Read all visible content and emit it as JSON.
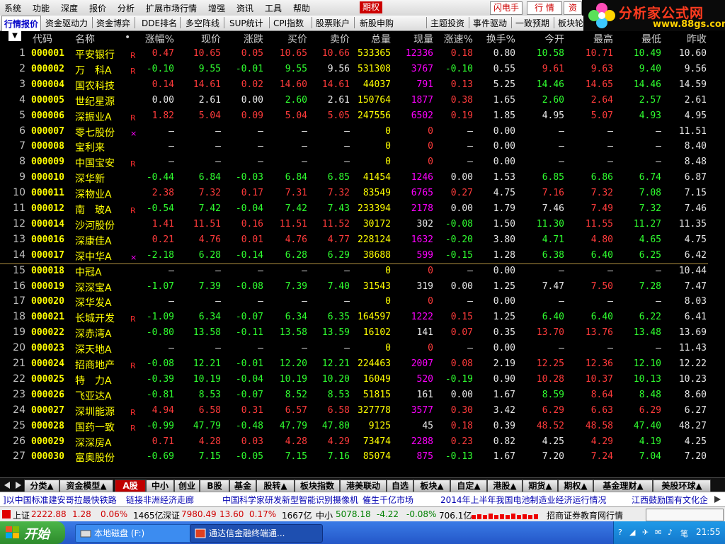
{
  "menu": {
    "items": [
      "系统",
      "功能",
      "深度",
      "报价",
      "分析",
      "扩展市场行情",
      "增强",
      "资讯",
      "工具",
      "帮助",
      "期权"
    ],
    "flash_trade": "闪电手",
    "quote": "行 情",
    "info": "资"
  },
  "logo": {
    "brand": "分析家公式网",
    "url": "www.88gs.com"
  },
  "func_tabs": [
    "行情报价",
    "资金驱动力",
    "资金博弈",
    "DDE排名",
    "多空阵线",
    "SUP统计",
    "CPI指数",
    "股票账户",
    "新股申购",
    "主题投资",
    "事件驱动",
    "一致预期",
    "板块轮"
  ],
  "table": {
    "headers": {
      "idx": "▼",
      "code": "代码",
      "name": "名称",
      "dot": "•",
      "cols": [
        "涨幅%",
        "现价",
        "涨跌",
        "买价",
        "卖价",
        "总量",
        "现量",
        "涨速%",
        "换手%",
        "今开",
        "最高",
        "最低",
        "昨收"
      ]
    },
    "rows": [
      {
        "i": "1",
        "code": "000001",
        "name": "平安银行",
        "flag": "R",
        "v": [
          "0.47",
          "10.65",
          "0.05",
          "10.65",
          "10.66",
          "533365",
          "12336",
          "0.18",
          "0.80",
          "10.58",
          "10.71",
          "10.49",
          "10.60"
        ],
        "c": [
          "u",
          "u",
          "u",
          "u",
          "u",
          "y",
          "m",
          "u",
          "w",
          "d",
          "u",
          "d",
          "w"
        ]
      },
      {
        "i": "2",
        "code": "000002",
        "name": "万　科A",
        "flag": "R",
        "v": [
          "-0.10",
          "9.55",
          "-0.01",
          "9.55",
          "9.56",
          "531308",
          "3767",
          "-0.10",
          "0.55",
          "9.61",
          "9.63",
          "9.40",
          "9.56"
        ],
        "c": [
          "d",
          "d",
          "d",
          "d",
          "w",
          "y",
          "m",
          "d",
          "w",
          "u",
          "u",
          "d",
          "w"
        ]
      },
      {
        "i": "3",
        "code": "000004",
        "name": "国农科技",
        "flag": "",
        "v": [
          "0.14",
          "14.61",
          "0.02",
          "14.60",
          "14.61",
          "44037",
          "791",
          "0.13",
          "5.25",
          "14.46",
          "14.65",
          "14.46",
          "14.59"
        ],
        "c": [
          "u",
          "u",
          "u",
          "u",
          "u",
          "y",
          "m",
          "u",
          "w",
          "d",
          "u",
          "d",
          "w"
        ]
      },
      {
        "i": "4",
        "code": "000005",
        "name": "世纪星源",
        "flag": "",
        "v": [
          "0.00",
          "2.61",
          "0.00",
          "2.60",
          "2.61",
          "150764",
          "1877",
          "0.38",
          "1.65",
          "2.60",
          "2.64",
          "2.57",
          "2.61"
        ],
        "c": [
          "w",
          "w",
          "w",
          "d",
          "w",
          "y",
          "m",
          "u",
          "w",
          "d",
          "u",
          "d",
          "w"
        ]
      },
      {
        "i": "5",
        "code": "000006",
        "name": "深振业A",
        "flag": "R",
        "v": [
          "1.82",
          "5.04",
          "0.09",
          "5.04",
          "5.05",
          "247556",
          "6502",
          "0.19",
          "1.85",
          "4.95",
          "5.07",
          "4.93",
          "4.95"
        ],
        "c": [
          "u",
          "u",
          "u",
          "u",
          "u",
          "y",
          "m",
          "u",
          "w",
          "w",
          "u",
          "d",
          "w"
        ]
      },
      {
        "i": "6",
        "code": "000007",
        "name": "零七股份",
        "flag": "×",
        "v": [
          "—",
          "—",
          "—",
          "—",
          "—",
          "0",
          "0",
          "—",
          "0.00",
          "—",
          "—",
          "—",
          "11.51"
        ],
        "c": [
          "w",
          "w",
          "w",
          "w",
          "w",
          "y",
          "u",
          "w",
          "w",
          "w",
          "w",
          "w",
          "w"
        ]
      },
      {
        "i": "7",
        "code": "000008",
        "name": "宝利来",
        "flag": "",
        "v": [
          "—",
          "—",
          "—",
          "—",
          "—",
          "0",
          "0",
          "—",
          "0.00",
          "—",
          "—",
          "—",
          "8.40"
        ],
        "c": [
          "w",
          "w",
          "w",
          "w",
          "w",
          "y",
          "u",
          "w",
          "w",
          "w",
          "w",
          "w",
          "w"
        ]
      },
      {
        "i": "8",
        "code": "000009",
        "name": "中国宝安",
        "flag": "R",
        "v": [
          "—",
          "—",
          "—",
          "—",
          "—",
          "0",
          "0",
          "—",
          "0.00",
          "—",
          "—",
          "—",
          "8.48"
        ],
        "c": [
          "w",
          "w",
          "w",
          "w",
          "w",
          "y",
          "u",
          "w",
          "w",
          "w",
          "w",
          "w",
          "w"
        ]
      },
      {
        "i": "9",
        "code": "000010",
        "name": "深华新",
        "flag": "",
        "v": [
          "-0.44",
          "6.84",
          "-0.03",
          "6.84",
          "6.85",
          "41454",
          "1246",
          "0.00",
          "1.53",
          "6.85",
          "6.86",
          "6.74",
          "6.87"
        ],
        "c": [
          "d",
          "d",
          "d",
          "d",
          "d",
          "y",
          "m",
          "w",
          "w",
          "d",
          "d",
          "d",
          "w"
        ]
      },
      {
        "i": "10",
        "code": "000011",
        "name": "深物业A",
        "flag": "",
        "v": [
          "2.38",
          "7.32",
          "0.17",
          "7.31",
          "7.32",
          "83549",
          "6765",
          "0.27",
          "4.75",
          "7.16",
          "7.32",
          "7.08",
          "7.15"
        ],
        "c": [
          "u",
          "u",
          "u",
          "u",
          "u",
          "y",
          "m",
          "u",
          "w",
          "u",
          "u",
          "d",
          "w"
        ]
      },
      {
        "i": "11",
        "code": "000012",
        "name": "南　玻A",
        "flag": "R",
        "v": [
          "-0.54",
          "7.42",
          "-0.04",
          "7.42",
          "7.43",
          "233394",
          "2178",
          "0.00",
          "1.79",
          "7.46",
          "7.49",
          "7.32",
          "7.46"
        ],
        "c": [
          "d",
          "d",
          "d",
          "d",
          "d",
          "y",
          "m",
          "w",
          "w",
          "w",
          "u",
          "d",
          "w"
        ]
      },
      {
        "i": "12",
        "code": "000014",
        "name": "沙河股份",
        "flag": "",
        "v": [
          "1.41",
          "11.51",
          "0.16",
          "11.51",
          "11.52",
          "30172",
          "302",
          "-0.08",
          "1.50",
          "11.30",
          "11.55",
          "11.27",
          "11.35"
        ],
        "c": [
          "u",
          "u",
          "u",
          "u",
          "u",
          "y",
          "w",
          "d",
          "w",
          "d",
          "u",
          "d",
          "w"
        ]
      },
      {
        "i": "13",
        "code": "000016",
        "name": "深康佳A",
        "flag": "",
        "v": [
          "0.21",
          "4.76",
          "0.01",
          "4.76",
          "4.77",
          "228124",
          "1632",
          "-0.20",
          "3.80",
          "4.71",
          "4.80",
          "4.65",
          "4.75"
        ],
        "c": [
          "u",
          "u",
          "u",
          "u",
          "u",
          "y",
          "m",
          "d",
          "w",
          "d",
          "u",
          "d",
          "w"
        ]
      },
      {
        "i": "14",
        "code": "000017",
        "name": "深中华A",
        "flag": "×",
        "v": [
          "-2.18",
          "6.28",
          "-0.14",
          "6.28",
          "6.29",
          "38688",
          "599",
          "-0.15",
          "1.28",
          "6.38",
          "6.40",
          "6.25",
          "6.42"
        ],
        "c": [
          "d",
          "d",
          "d",
          "d",
          "d",
          "y",
          "m",
          "d",
          "w",
          "d",
          "d",
          "d",
          "w"
        ]
      },
      {
        "i": "15",
        "code": "000018",
        "name": "中冠A",
        "flag": "",
        "v": [
          "—",
          "—",
          "—",
          "—",
          "—",
          "0",
          "0",
          "—",
          "0.00",
          "—",
          "—",
          "—",
          "10.44"
        ],
        "c": [
          "w",
          "w",
          "w",
          "w",
          "w",
          "y",
          "u",
          "w",
          "w",
          "w",
          "w",
          "w",
          "w"
        ]
      },
      {
        "i": "16",
        "code": "000019",
        "name": "深深宝A",
        "flag": "",
        "v": [
          "-1.07",
          "7.39",
          "-0.08",
          "7.39",
          "7.40",
          "31543",
          "319",
          "0.00",
          "1.25",
          "7.47",
          "7.50",
          "7.28",
          "7.47"
        ],
        "c": [
          "d",
          "d",
          "d",
          "d",
          "d",
          "y",
          "w",
          "w",
          "w",
          "w",
          "u",
          "d",
          "w"
        ]
      },
      {
        "i": "17",
        "code": "000020",
        "name": "深华发A",
        "flag": "",
        "v": [
          "—",
          "—",
          "—",
          "—",
          "—",
          "0",
          "0",
          "—",
          "0.00",
          "—",
          "—",
          "—",
          "8.03"
        ],
        "c": [
          "w",
          "w",
          "w",
          "w",
          "w",
          "y",
          "u",
          "w",
          "w",
          "w",
          "w",
          "w",
          "w"
        ]
      },
      {
        "i": "18",
        "code": "000021",
        "name": "长城开发",
        "flag": "R",
        "v": [
          "-1.09",
          "6.34",
          "-0.07",
          "6.34",
          "6.35",
          "164597",
          "1222",
          "0.15",
          "1.25",
          "6.40",
          "6.40",
          "6.22",
          "6.41"
        ],
        "c": [
          "d",
          "d",
          "d",
          "d",
          "d",
          "y",
          "m",
          "u",
          "w",
          "d",
          "d",
          "d",
          "w"
        ]
      },
      {
        "i": "19",
        "code": "000022",
        "name": "深赤湾A",
        "flag": "",
        "v": [
          "-0.80",
          "13.58",
          "-0.11",
          "13.58",
          "13.59",
          "16102",
          "141",
          "0.07",
          "0.35",
          "13.70",
          "13.76",
          "13.48",
          "13.69"
        ],
        "c": [
          "d",
          "d",
          "d",
          "d",
          "d",
          "y",
          "w",
          "u",
          "w",
          "u",
          "u",
          "d",
          "w"
        ]
      },
      {
        "i": "20",
        "code": "000023",
        "name": "深天地A",
        "flag": "",
        "v": [
          "—",
          "—",
          "—",
          "—",
          "—",
          "0",
          "0",
          "—",
          "0.00",
          "—",
          "—",
          "—",
          "11.43"
        ],
        "c": [
          "w",
          "w",
          "w",
          "w",
          "w",
          "y",
          "u",
          "w",
          "w",
          "w",
          "w",
          "w",
          "w"
        ]
      },
      {
        "i": "21",
        "code": "000024",
        "name": "招商地产",
        "flag": "R",
        "v": [
          "-0.08",
          "12.21",
          "-0.01",
          "12.20",
          "12.21",
          "224463",
          "2007",
          "0.08",
          "2.19",
          "12.25",
          "12.36",
          "12.10",
          "12.22"
        ],
        "c": [
          "d",
          "d",
          "d",
          "d",
          "d",
          "y",
          "m",
          "u",
          "w",
          "u",
          "u",
          "d",
          "w"
        ]
      },
      {
        "i": "22",
        "code": "000025",
        "name": "特　力A",
        "flag": "",
        "v": [
          "-0.39",
          "10.19",
          "-0.04",
          "10.19",
          "10.20",
          "16049",
          "520",
          "-0.19",
          "0.90",
          "10.28",
          "10.37",
          "10.13",
          "10.23"
        ],
        "c": [
          "d",
          "d",
          "d",
          "d",
          "d",
          "y",
          "m",
          "d",
          "w",
          "u",
          "u",
          "d",
          "w"
        ]
      },
      {
        "i": "23",
        "code": "000026",
        "name": "飞亚达A",
        "flag": "",
        "v": [
          "-0.81",
          "8.53",
          "-0.07",
          "8.52",
          "8.53",
          "51815",
          "161",
          "0.00",
          "1.67",
          "8.59",
          "8.64",
          "8.48",
          "8.60"
        ],
        "c": [
          "d",
          "d",
          "d",
          "d",
          "d",
          "y",
          "w",
          "w",
          "w",
          "d",
          "u",
          "d",
          "w"
        ]
      },
      {
        "i": "24",
        "code": "000027",
        "name": "深圳能源",
        "flag": "R",
        "v": [
          "4.94",
          "6.58",
          "0.31",
          "6.57",
          "6.58",
          "327778",
          "3577",
          "0.30",
          "3.42",
          "6.29",
          "6.63",
          "6.29",
          "6.27"
        ],
        "c": [
          "u",
          "u",
          "u",
          "u",
          "u",
          "y",
          "m",
          "u",
          "w",
          "u",
          "u",
          "u",
          "w"
        ]
      },
      {
        "i": "25",
        "code": "000028",
        "name": "国药一致",
        "flag": "R",
        "v": [
          "-0.99",
          "47.79",
          "-0.48",
          "47.79",
          "47.80",
          "9125",
          "45",
          "0.18",
          "0.39",
          "48.52",
          "48.58",
          "47.40",
          "48.27"
        ],
        "c": [
          "d",
          "d",
          "d",
          "d",
          "d",
          "y",
          "w",
          "u",
          "w",
          "u",
          "u",
          "d",
          "w"
        ]
      },
      {
        "i": "26",
        "code": "000029",
        "name": "深深房A",
        "flag": "",
        "v": [
          "0.71",
          "4.28",
          "0.03",
          "4.28",
          "4.29",
          "73474",
          "2288",
          "0.23",
          "0.82",
          "4.25",
          "4.29",
          "4.19",
          "4.25"
        ],
        "c": [
          "u",
          "u",
          "u",
          "u",
          "u",
          "y",
          "m",
          "u",
          "w",
          "w",
          "u",
          "d",
          "w"
        ]
      },
      {
        "i": "27",
        "code": "000030",
        "name": "富奥股份",
        "flag": "",
        "v": [
          "-0.69",
          "7.15",
          "-0.05",
          "7.15",
          "7.16",
          "85074",
          "875",
          "-0.13",
          "1.67",
          "7.20",
          "7.24",
          "7.04",
          "7.20"
        ],
        "c": [
          "d",
          "d",
          "d",
          "d",
          "d",
          "y",
          "m",
          "d",
          "w",
          "w",
          "u",
          "d",
          "w"
        ]
      }
    ]
  },
  "bottom_tabs": [
    "分类▲",
    "资金模型▲",
    "A股",
    "中小",
    "创业",
    "B股",
    "基金",
    "股转▲",
    "板块指数",
    "港美联动",
    "自选",
    "板块▲",
    "自定▲",
    "港股▲",
    "期货▲",
    "期权▲",
    "基金理财▲",
    "美股环球▲"
  ],
  "news": [
    "]以中国标准建安哥拉最快铁路",
    "链接非洲经济走廊",
    "中国科学家研发新型智能识别摄像机",
    "催生千亿市场",
    "2014年上半年我国电池制造业经济运行情况",
    "江西鼓励国有文化企"
  ],
  "index_bar": {
    "sh_label": "上证",
    "sh_val": "2222.88",
    "sh_chg": "1.28",
    "sh_pct": "0.06%",
    "sh_amt": "1465亿",
    "sz_label": "深证",
    "sz_val": "7980.49",
    "sz_chg": "13.60",
    "sz_pct": "0.17%",
    "sz_amt": "1667亿",
    "zx_label": "中小",
    "zx_val": "5078.18",
    "zx_chg": "-4.22",
    "zx_pct": "-0.08%",
    "zx_amt": "706.1亿",
    "broker": "招商证券教育网行情"
  },
  "taskbar": {
    "start": "开始",
    "tasks": [
      "本地磁盘 (F:)",
      "通达信金融终端通..."
    ],
    "clock": "21:55"
  }
}
